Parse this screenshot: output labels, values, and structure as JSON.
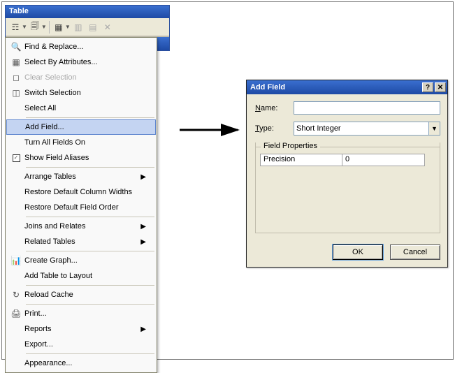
{
  "table_window": {
    "title": "Table",
    "toolbar": [
      {
        "name": "list-icon",
        "glyph": "☶",
        "dd": true
      },
      {
        "name": "copy-icon",
        "glyph": "🗐",
        "dd": true
      },
      {
        "name": "sep"
      },
      {
        "name": "table-icon",
        "glyph": "▦",
        "dd": true
      },
      {
        "name": "grid-add-icon",
        "glyph": "▥",
        "disabled": true
      },
      {
        "name": "grid-del-icon",
        "glyph": "▤",
        "disabled": true
      },
      {
        "name": "close-x-icon",
        "glyph": "✕",
        "disabled": true
      }
    ]
  },
  "menu": [
    {
      "type": "item",
      "icon": "binoculars-icon",
      "glyph": "🔍",
      "label": "Find & Replace..."
    },
    {
      "type": "item",
      "icon": "select-attrs-icon",
      "glyph": "▦",
      "label": "Select By Attributes..."
    },
    {
      "type": "item",
      "icon": "clear-sel-icon",
      "glyph": "◻",
      "label": "Clear Selection",
      "disabled": true
    },
    {
      "type": "item",
      "icon": "switch-sel-icon",
      "glyph": "◫",
      "label": "Switch Selection"
    },
    {
      "type": "item",
      "icon": "select-all-icon",
      "glyph": "",
      "label": "Select All"
    },
    {
      "type": "sep"
    },
    {
      "type": "item",
      "icon": "add-field-icon",
      "glyph": "",
      "label": "Add Field...",
      "highlight": true
    },
    {
      "type": "item",
      "icon": "fields-on-icon",
      "glyph": "",
      "label": "Turn All Fields On"
    },
    {
      "type": "item",
      "icon": "aliases-icon",
      "glyph": "",
      "label": "Show Field Aliases",
      "checked": true
    },
    {
      "type": "sep"
    },
    {
      "type": "item",
      "icon": "arrange-icon",
      "glyph": "",
      "label": "Arrange Tables",
      "submenu": true
    },
    {
      "type": "item",
      "icon": "restore-widths-icon",
      "glyph": "",
      "label": "Restore Default Column Widths"
    },
    {
      "type": "item",
      "icon": "restore-order-icon",
      "glyph": "",
      "label": "Restore Default Field Order"
    },
    {
      "type": "sep"
    },
    {
      "type": "item",
      "icon": "joins-icon",
      "glyph": "",
      "label": "Joins and Relates",
      "submenu": true
    },
    {
      "type": "item",
      "icon": "related-icon",
      "glyph": "",
      "label": "Related Tables",
      "submenu": true
    },
    {
      "type": "sep"
    },
    {
      "type": "item",
      "icon": "graph-icon",
      "glyph": "📊",
      "label": "Create Graph..."
    },
    {
      "type": "item",
      "icon": "layout-icon",
      "glyph": "",
      "label": "Add Table to Layout"
    },
    {
      "type": "sep"
    },
    {
      "type": "item",
      "icon": "reload-icon",
      "glyph": "↻",
      "label": "Reload Cache"
    },
    {
      "type": "sep"
    },
    {
      "type": "item",
      "icon": "print-icon",
      "glyph": "🖨",
      "label": "Print..."
    },
    {
      "type": "item",
      "icon": "reports-icon",
      "glyph": "",
      "label": "Reports",
      "submenu": true
    },
    {
      "type": "item",
      "icon": "export-icon",
      "glyph": "",
      "label": "Export..."
    },
    {
      "type": "sep"
    },
    {
      "type": "item",
      "icon": "appearance-icon",
      "glyph": "",
      "label": "Appearance..."
    }
  ],
  "dialog": {
    "title": "Add Field",
    "name_label_pre": "N",
    "name_label_post": "ame:",
    "name_value": "",
    "type_label_pre": "T",
    "type_label_post": "ype:",
    "type_value": "Short Integer",
    "group_title": "Field Properties",
    "prop_name": "Precision",
    "prop_value": "0",
    "ok": "OK",
    "cancel": "Cancel"
  }
}
